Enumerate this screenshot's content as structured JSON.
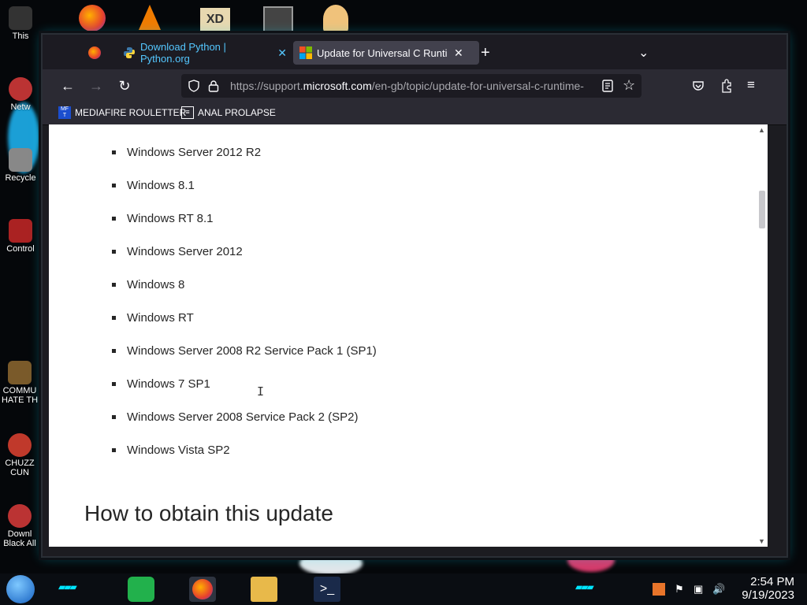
{
  "desktop": {
    "icons": [
      {
        "label": "This",
        "color": "#c0392b"
      },
      {
        "label": "Netw",
        "color": "#c0392b"
      },
      {
        "label": "Recycle",
        "color": "#c0392b"
      },
      {
        "label": "Control",
        "color": "#c0392b"
      },
      {
        "label": "COMMU HATE TH",
        "color": "#c0392b"
      },
      {
        "label": "CHUZZ CUN",
        "color": "#c0392b"
      },
      {
        "label": "Downl Black All",
        "color": "#c0392b"
      }
    ]
  },
  "browser": {
    "tabs": [
      {
        "label": "",
        "icon": "firefox-icon"
      },
      {
        "label": "Download Python | Python.org",
        "icon": "python-icon"
      },
      {
        "label": "Update for Universal C Runtime",
        "icon": "microsoft-icon",
        "active": true
      }
    ],
    "new_tab_label": "+",
    "tab_list_label": "⌄",
    "url_prefix": "https://support.",
    "url_domain": "microsoft.com",
    "url_suffix": "/en-gb/topic/update-for-universal-c-runtime-",
    "bookmarks": [
      {
        "label": "MEDIAFIRE ROULETTER",
        "icon": "mediafire-icon"
      },
      {
        "label": "ANAL PROLAPSE",
        "icon": "bookmark-page-icon"
      }
    ]
  },
  "page": {
    "os_list": [
      "Windows Server 2012 R2",
      "Windows 8.1",
      "Windows RT 8.1",
      "Windows Server 2012",
      "Windows 8",
      "Windows RT",
      "Windows Server 2008 R2 Service Pack 1 (SP1)",
      "Windows 7 SP1",
      "Windows Server 2008 Service Pack 2 (SP2)",
      "Windows Vista SP2"
    ],
    "section_heading": "How to obtain this update"
  },
  "taskbar": {
    "time": "2:54 PM",
    "date": "9/19/2023"
  },
  "colors": {
    "accent_cyan": "#00e5ff",
    "tab_link": "#54c7ff",
    "text_dark": "#262626"
  }
}
